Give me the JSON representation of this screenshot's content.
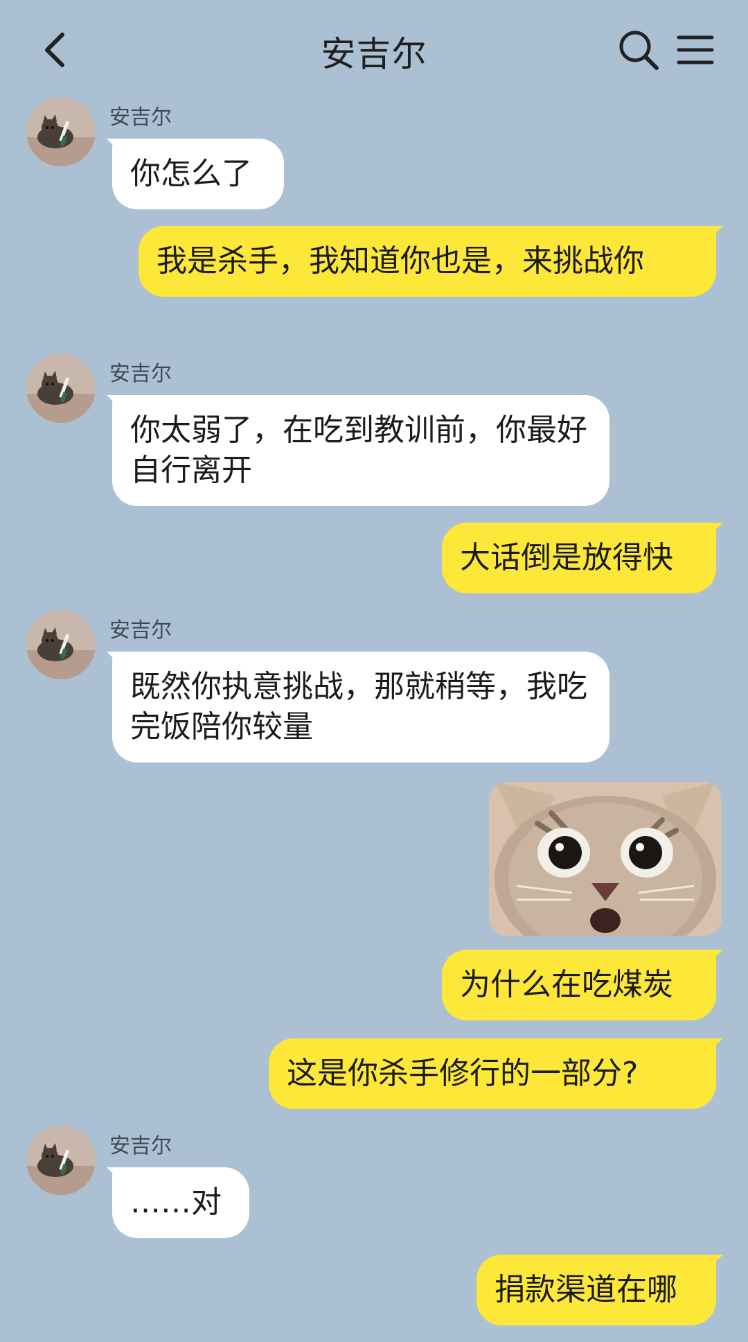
{
  "header": {
    "title": "安吉尔",
    "back_icon": "chevron-left-icon",
    "search_icon": "search-icon",
    "menu_icon": "hamburger-menu-icon"
  },
  "contact": {
    "name": "安吉尔",
    "avatar": "cat-holding-knife-avatar"
  },
  "messages": [
    {
      "side": "in",
      "sender": "安吉尔",
      "text": "你怎么了"
    },
    {
      "side": "out",
      "text": "我是杀手，我知道你也是，来挑战你"
    },
    {
      "side": "in",
      "sender": "安吉尔",
      "text": "你太弱了，在吃到教训前，你最好自行离开"
    },
    {
      "side": "out",
      "text": "大话倒是放得快"
    },
    {
      "side": "in",
      "sender": "安吉尔",
      "text": "既然你执意挑战，那就稍等，我吃完饭陪你较量"
    },
    {
      "side": "out",
      "type": "sticker",
      "sticker": "shocked-cat-face-sticker"
    },
    {
      "side": "out",
      "text": "为什么在吃煤炭"
    },
    {
      "side": "out",
      "text": "这是你杀手修行的一部分?"
    },
    {
      "side": "in",
      "sender": "安吉尔",
      "text": "……对"
    },
    {
      "side": "out",
      "text": "捐款渠道在哪"
    }
  ],
  "colors": {
    "background": "#abc1d3",
    "outgoing_bubble": "#fde83a",
    "incoming_bubble": "#ffffff",
    "text": "#1b1b1b"
  }
}
